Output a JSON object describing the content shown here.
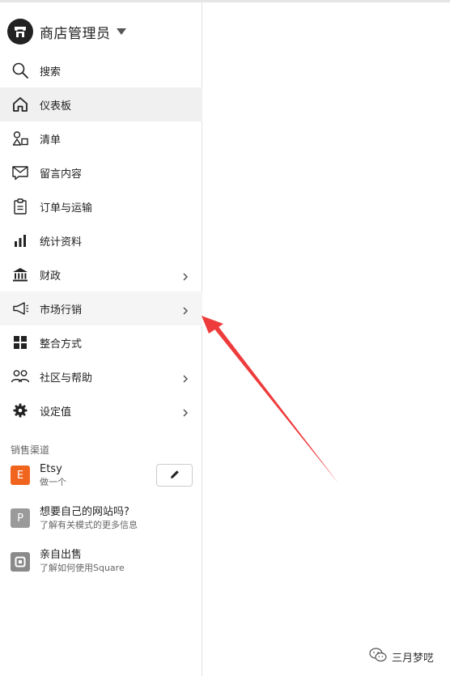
{
  "shop": {
    "name": "商店管理员"
  },
  "nav": {
    "items": [
      {
        "label": "搜索",
        "icon": "search-icon",
        "chevron": false,
        "state": "normal"
      },
      {
        "label": "仪表板",
        "icon": "home-icon",
        "chevron": false,
        "state": "active"
      },
      {
        "label": "清单",
        "icon": "shapes-icon",
        "chevron": false,
        "state": "normal"
      },
      {
        "label": "留言内容",
        "icon": "mail-icon",
        "chevron": false,
        "state": "normal"
      },
      {
        "label": "订单与运输",
        "icon": "clipboard-icon",
        "chevron": false,
        "state": "normal"
      },
      {
        "label": "统计资料",
        "icon": "bar-chart-icon",
        "chevron": false,
        "state": "normal"
      },
      {
        "label": "财政",
        "icon": "bank-icon",
        "chevron": true,
        "state": "normal"
      },
      {
        "label": "市场行销",
        "icon": "megaphone-icon",
        "chevron": true,
        "state": "hover"
      },
      {
        "label": "整合方式",
        "icon": "grid-icon",
        "chevron": false,
        "state": "normal"
      },
      {
        "label": "社区与帮助",
        "icon": "people-icon",
        "chevron": true,
        "state": "normal"
      },
      {
        "label": "设定值",
        "icon": "gear-icon",
        "chevron": true,
        "state": "normal"
      }
    ]
  },
  "sales_channels": {
    "title": "销售渠道",
    "items": [
      {
        "badge": "E",
        "title": "Etsy",
        "subtitle": "做一个",
        "badge_color": "#f1641e"
      },
      {
        "badge": "P",
        "title": "想要自己的网站吗?",
        "subtitle": "了解有关模式的更多信息",
        "badge_color": "#9a9a9a"
      },
      {
        "badge": "",
        "title": "亲自出售",
        "subtitle": "了解如何使用Square",
        "badge_color": "#8a8a8a"
      }
    ]
  },
  "watermark": {
    "text": "三月梦呓"
  },
  "colors": {
    "accent_arrow": "#ee3b3b",
    "active_bg": "#f0f0f0"
  }
}
